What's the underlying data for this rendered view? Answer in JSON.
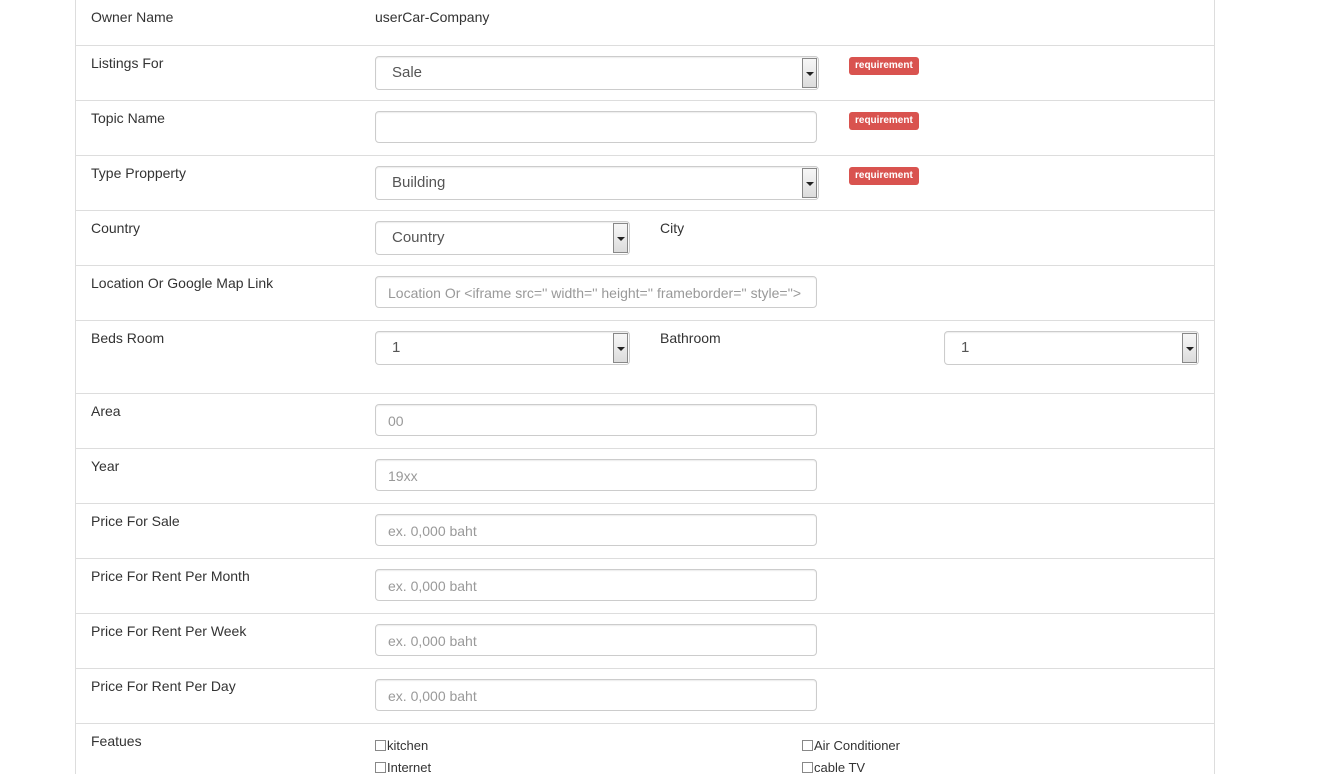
{
  "owner": {
    "label": "Owner Name",
    "value": "userCar-Company"
  },
  "listings_for": {
    "label": "Listings For",
    "selected": "Sale",
    "badge": "requirement"
  },
  "topic": {
    "label": "Topic Name",
    "value": "",
    "badge": "requirement"
  },
  "type_property": {
    "label": "Type Propperty",
    "selected": "Building",
    "badge": "requirement"
  },
  "country": {
    "label": "Country",
    "selected": "Country",
    "city_label": "City"
  },
  "location": {
    "label": "Location Or Google Map Link",
    "placeholder": "Location Or <iframe src='' width='' height='' frameborder='' style=''>"
  },
  "beds": {
    "label": "Beds Room",
    "selected": "1",
    "bath_label": "Bathroom",
    "bath_selected": "1"
  },
  "area": {
    "label": "Area",
    "placeholder": "00"
  },
  "year": {
    "label": "Year",
    "placeholder": "19xx"
  },
  "price_sale": {
    "label": "Price For Sale",
    "placeholder": "ex. 0,000 baht"
  },
  "price_month": {
    "label": "Price For Rent Per Month",
    "placeholder": "ex. 0,000 baht"
  },
  "price_week": {
    "label": "Price For Rent Per Week",
    "placeholder": "ex. 0,000 baht"
  },
  "price_day": {
    "label": "Price For Rent Per Day",
    "placeholder": "ex. 0,000 baht"
  },
  "features": {
    "label": "Featues",
    "items": [
      "kitchen",
      "Air Conditioner",
      "Internet",
      "cable TV"
    ]
  },
  "colors": {
    "badge": "#d9534f",
    "border": "#dddddd",
    "placeholder": "#999999"
  }
}
